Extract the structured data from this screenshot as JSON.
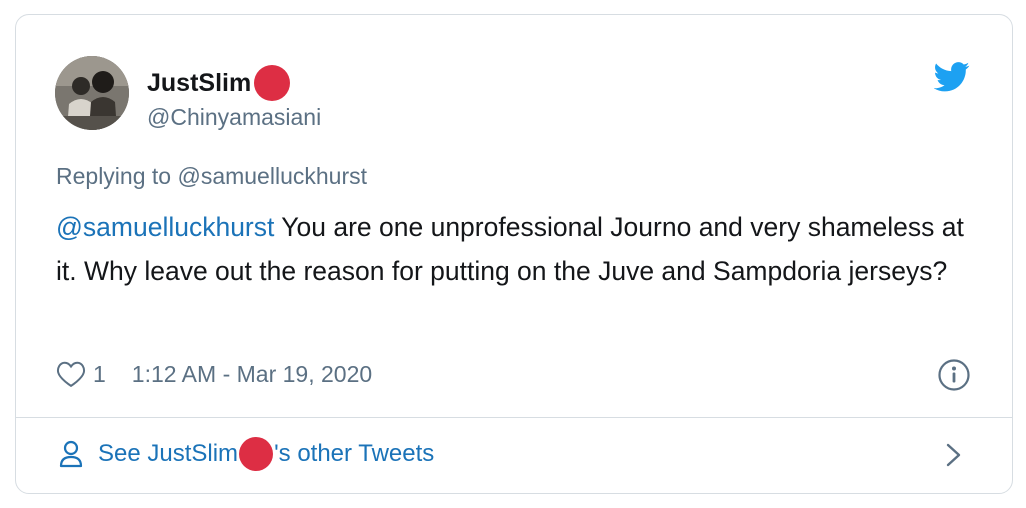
{
  "user": {
    "display_name": "JustSlim",
    "handle": "@Chinyamasiani",
    "emoji": "red-circle"
  },
  "tweet": {
    "replying_prefix": "Replying to ",
    "replying_to": "@samuelluckhurst",
    "mention": "@samuelluckhurst",
    "text": " You are one unprofessional Journo and very shameless at it. Why leave out the reason for putting on the Juve and Sampdoria jerseys?",
    "likes": "1",
    "timestamp": "1:12 AM - Mar 19, 2020"
  },
  "footer": {
    "prefix": "See JustSlim",
    "suffix": "'s other Tweets"
  },
  "icons": {
    "brand": "twitter-bird-icon",
    "like": "heart-icon",
    "info": "info-icon",
    "profile": "person-icon",
    "next": "chevron-right-icon"
  },
  "colors": {
    "link": "#1b73b8",
    "twitter_blue": "#1da1f2",
    "secondary_text": "#5b7083",
    "emoji_red": "#dd2e44",
    "border": "#d7dde2"
  }
}
